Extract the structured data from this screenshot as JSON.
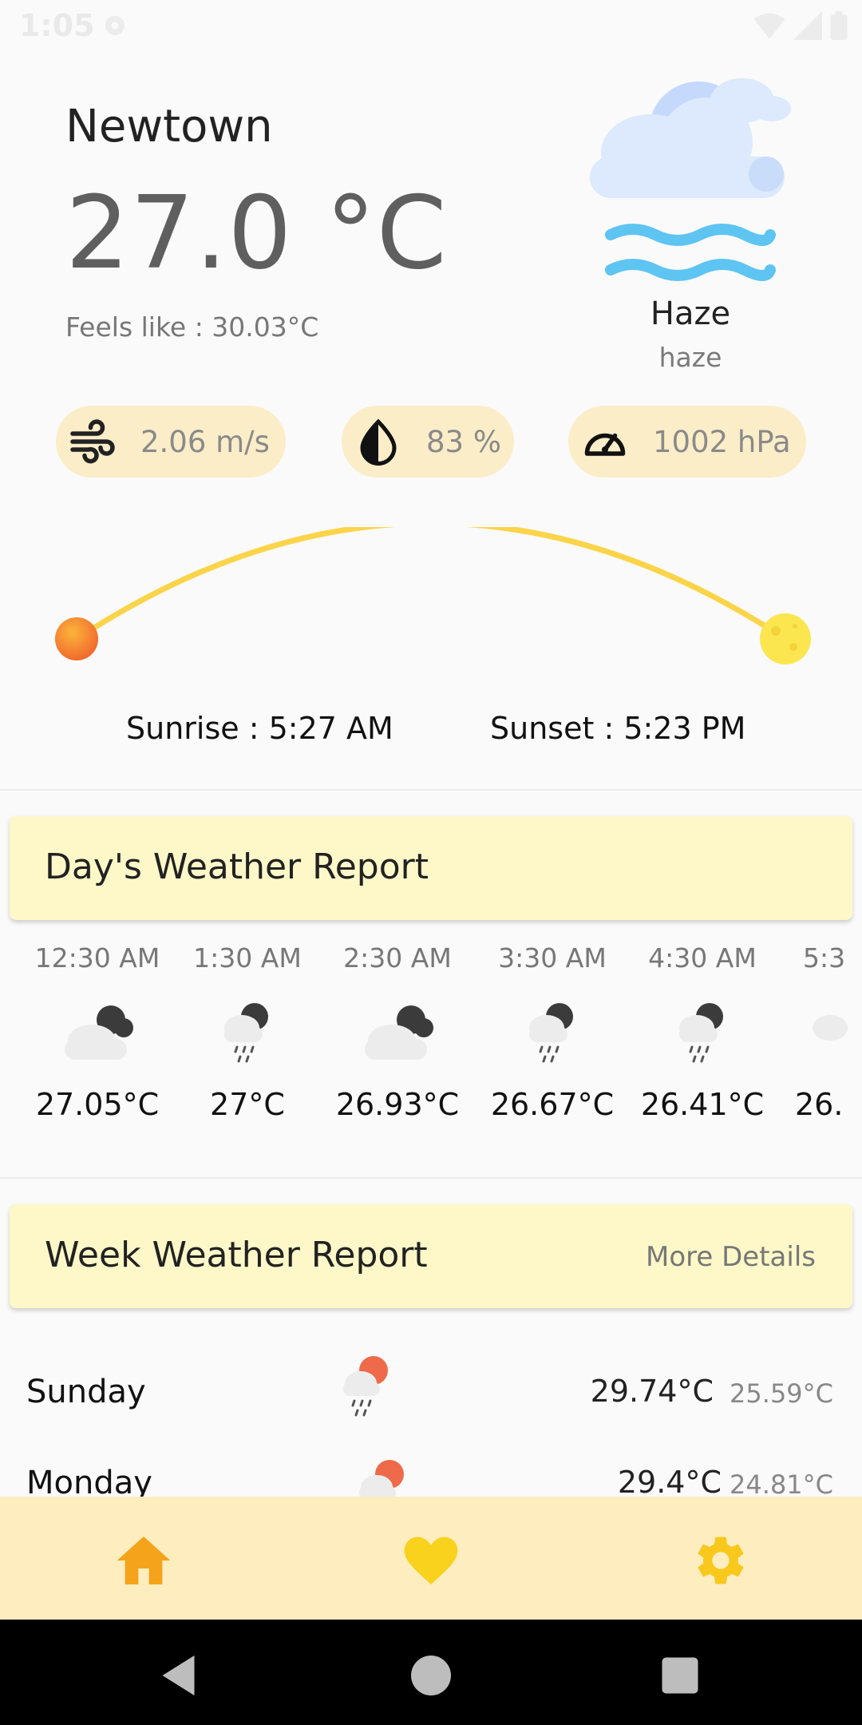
{
  "status_bar": {
    "time": "1:05"
  },
  "current": {
    "city": "Newtown",
    "temperature": "27.0 °C",
    "feels_like": "Feels like : 30.03°C",
    "condition": "Haze",
    "description": "haze"
  },
  "stats": {
    "wind": "2.06 m/s",
    "humidity": "83 %",
    "pressure": "1002 hPa"
  },
  "sun": {
    "sunrise": "Sunrise : 5:27 AM",
    "sunset": "Sunset : 5:23 PM"
  },
  "day_report": {
    "title": "Day's Weather Report",
    "hours": [
      {
        "time": "12:30 AM",
        "icon": "cloudy-night-icon",
        "temp": "27.05°C"
      },
      {
        "time": "1:30 AM",
        "icon": "rain-night-icon",
        "temp": "27°C"
      },
      {
        "time": "2:30 AM",
        "icon": "cloudy-night-icon",
        "temp": "26.93°C"
      },
      {
        "time": "3:30 AM",
        "icon": "rain-night-icon",
        "temp": "26.67°C"
      },
      {
        "time": "4:30 AM",
        "icon": "rain-night-icon",
        "temp": "26.41°C"
      },
      {
        "time": "5:3",
        "icon": "rain-night-icon",
        "temp": "26."
      }
    ]
  },
  "week_report": {
    "title": "Week Weather Report",
    "more_label": "More Details",
    "days": [
      {
        "day": "Sunday",
        "icon": "rain-sun-icon",
        "max": "29.74°C",
        "min": "25.59°C"
      },
      {
        "day": "Monday",
        "icon": "rain-sun-icon",
        "max": "29.4°C",
        "min": "24.81°C"
      }
    ]
  },
  "nav": {
    "items": [
      {
        "name": "home-icon",
        "color": "#f5a31a"
      },
      {
        "name": "heart-icon",
        "color": "#f8d21c"
      },
      {
        "name": "gear-icon",
        "color": "#f8c81c"
      }
    ]
  },
  "colors": {
    "accent_sun": "#fbd449",
    "pill_bg": "#fbedc8",
    "card_bg": "#fef8c8",
    "nav_bg": "#fdedbf"
  }
}
